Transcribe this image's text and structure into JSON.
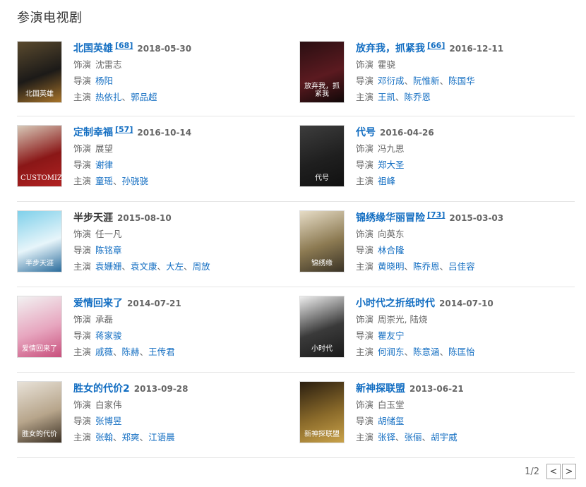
{
  "section": {
    "title": "参演电视剧"
  },
  "labels": {
    "role": "饰演",
    "director": "导演",
    "cast": "主演"
  },
  "items": [
    {
      "title": "北国英雄",
      "ref": "[68]",
      "date": "2018-05-30",
      "role": "沈雷志",
      "directors": [
        "杨阳"
      ],
      "cast": [
        "热依扎",
        "郭品超"
      ],
      "linked": true,
      "poster": {
        "text": "北国英雄",
        "colors": [
          "#5a4a2e",
          "#1c1a18",
          "#a8742a"
        ]
      }
    },
    {
      "title": "放弃我，抓紧我",
      "ref": "[66]",
      "date": "2016-12-11",
      "role": "霍骁",
      "directors": [
        "邓衍成",
        "阮惟新",
        "陈国华"
      ],
      "cast": [
        "王凯",
        "陈乔恩"
      ],
      "linked": true,
      "poster": {
        "text": "放弃我，抓紧我",
        "colors": [
          "#2a0f12",
          "#5b1a20",
          "#100808"
        ]
      }
    },
    {
      "title": "定制幸福",
      "ref": "[57]",
      "date": "2016-10-14",
      "role": "展望",
      "directors": [
        "谢律"
      ],
      "cast": [
        "童瑶",
        "孙骁骁"
      ],
      "linked": true,
      "poster": {
        "text": "CUSTOMIZE",
        "colors": [
          "#d7c9b8",
          "#8a1717",
          "#b22222"
        ]
      }
    },
    {
      "title": "代号",
      "ref": "",
      "date": "2016-04-26",
      "role": "冯九思",
      "directors": [
        "郑大圣"
      ],
      "cast": [
        "祖峰"
      ],
      "linked": true,
      "poster": {
        "text": "代号",
        "colors": [
          "#3d3d3d",
          "#1f1f1f",
          "#111111"
        ]
      }
    },
    {
      "title": "半步天涯",
      "ref": "",
      "date": "2015-08-10",
      "role": "任一凡",
      "directors": [
        "陈铭章"
      ],
      "cast": [
        "袁姗姗",
        "袁文康",
        "大左",
        "周放"
      ],
      "linked": false,
      "poster": {
        "text": "半步天涯",
        "colors": [
          "#7fd0ea",
          "#e7f5fa",
          "#2a6c9c"
        ]
      }
    },
    {
      "title": "锦绣缘华丽冒险",
      "ref": "[73]",
      "date": "2015-03-03",
      "role": "向英东",
      "directors": [
        "林合隆"
      ],
      "cast": [
        "黄晓明",
        "陈乔恩",
        "吕佳容"
      ],
      "linked": true,
      "poster": {
        "text": "锦绣缘",
        "colors": [
          "#e6dcc6",
          "#8c7a52",
          "#3a3326"
        ]
      }
    },
    {
      "title": "爱情回来了",
      "ref": "",
      "date": "2014-07-21",
      "role": "承磊",
      "directors": [
        "蒋家骏"
      ],
      "cast": [
        "戚薇",
        "陈赫",
        "王传君"
      ],
      "linked": true,
      "poster": {
        "text": "爱情回来了",
        "colors": [
          "#f2f2f2",
          "#e7a6bf",
          "#c84f7c"
        ]
      }
    },
    {
      "title": "小时代之折纸时代",
      "ref": "",
      "date": "2014-07-10",
      "role": "周崇光, 陆烧",
      "directors": [
        "瞿友宁"
      ],
      "cast": [
        "何润东",
        "陈意涵",
        "陈匡怡"
      ],
      "linked": true,
      "poster": {
        "text": "小时代",
        "colors": [
          "#eeeeee",
          "#3a3a3a",
          "#1a1a1a"
        ]
      }
    },
    {
      "title": "胜女的代价2",
      "ref": "",
      "date": "2013-09-28",
      "role": "白家伟",
      "directors": [
        "张博昱"
      ],
      "cast": [
        "张翰",
        "郑爽",
        "江语晨"
      ],
      "linked": true,
      "poster": {
        "text": "胜女的代价",
        "colors": [
          "#e8e2d8",
          "#b7a58b",
          "#3b3024"
        ]
      }
    },
    {
      "title": "新神探联盟",
      "ref": "",
      "date": "2013-06-21",
      "role": "白玉堂",
      "directors": [
        "胡储玺"
      ],
      "cast": [
        "张铎",
        "张俪",
        "胡宇威"
      ],
      "linked": true,
      "poster": {
        "text": "新神探联盟",
        "colors": [
          "#2a1e10",
          "#8a6a2a",
          "#c9a24a"
        ]
      }
    }
  ],
  "pager": {
    "text": "1/2",
    "prev": "<",
    "next": ">"
  }
}
